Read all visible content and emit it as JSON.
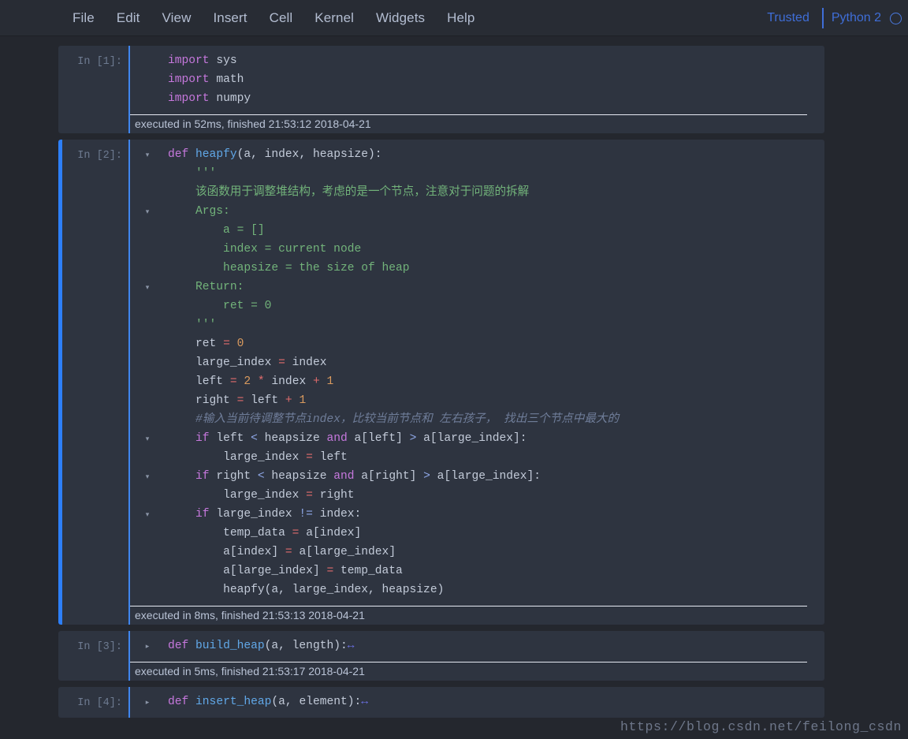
{
  "menubar": {
    "items": [
      {
        "label": "File",
        "name": "menu-file"
      },
      {
        "label": "Edit",
        "name": "menu-edit"
      },
      {
        "label": "View",
        "name": "menu-view"
      },
      {
        "label": "Insert",
        "name": "menu-insert"
      },
      {
        "label": "Cell",
        "name": "menu-cell"
      },
      {
        "label": "Kernel",
        "name": "menu-kernel"
      },
      {
        "label": "Widgets",
        "name": "menu-widgets"
      },
      {
        "label": "Help",
        "name": "menu-help"
      }
    ],
    "trusted_label": "Trusted",
    "kernel_name": "Python 2",
    "kernel_indicator_icon": "circle-idle-icon",
    "accent_color": "#3f6ed8"
  },
  "colors": {
    "page_background": "#24272e",
    "cell_background": "#2e3440",
    "menubar_background": "#282c34",
    "selected_cell_bar": "#2d7ff9",
    "code_border": "#3f86ef",
    "keyword": "#c678dd",
    "function": "#61a8e8",
    "string": "#72b37a",
    "number": "#d99a5e",
    "operator": "#e06c6c",
    "comparison": "#8fa8e8",
    "comment": "#6f7d99",
    "plain_text": "#c3cbd9",
    "prompt": "#6d7a90",
    "exec_text": "#b9c3d6"
  },
  "cells": [
    {
      "prompt": "In [1]:",
      "selected": false,
      "collapsed": false,
      "exec": "executed in 52ms, finished 21:53:12 2018-04-21",
      "folds": [
        "",
        "",
        ""
      ],
      "code_lines": [
        "import sys",
        "import math",
        "import numpy"
      ]
    },
    {
      "prompt": "In [2]:",
      "selected": true,
      "collapsed": false,
      "exec": "executed in 8ms, finished 21:53:13 2018-04-21",
      "code_lines": [
        "def heapfy(a, index, heapsize):",
        "    '''",
        "    该函数用于调整堆结构，考虑的是一个节点，注意对于问题的拆解",
        "    Args:",
        "        a = []",
        "        index = current node",
        "        heapsize = the size of heap",
        "    Return:",
        "        ret = 0",
        "    '''",
        "    ret = 0",
        "    large_index = index",
        "    left = 2 * index + 1",
        "    right = left + 1",
        "    #输入当前待调整节点index，比较当前节点和 左右孩子， 找出三个节点中最大的",
        "    if left < heapsize and a[left] > a[large_index]:",
        "        large_index = left",
        "    if right < heapsize and a[right] > a[large_index]:",
        "        large_index = right",
        "    if large_index != index:",
        "        temp_data = a[index]",
        "        a[index] = a[large_index]",
        "        a[large_index] = temp_data",
        "        heapfy(a, large_index, heapsize)"
      ]
    },
    {
      "prompt": "In [3]:",
      "selected": false,
      "collapsed": true,
      "exec": "executed in 5ms, finished 21:53:17 2018-04-21",
      "code_lines": [
        "def build_heap(a, length):"
      ],
      "collapse_marker": "↔"
    },
    {
      "prompt": "In [4]:",
      "selected": false,
      "collapsed": true,
      "exec": "",
      "code_lines": [
        "def insert_heap(a, element):"
      ],
      "collapse_marker": "↔"
    }
  ],
  "watermark": "https://blog.csdn.net/feilong_csdn"
}
